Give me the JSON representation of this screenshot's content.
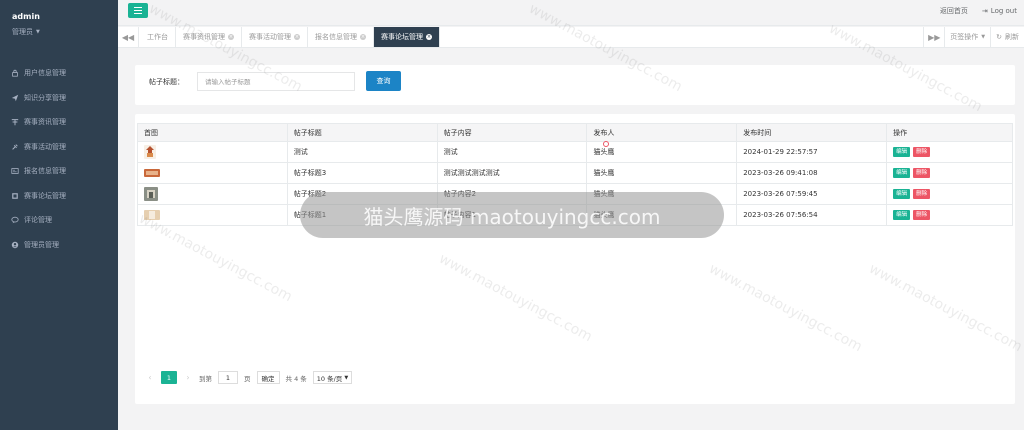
{
  "sidebar": {
    "user": "admin",
    "role": "管理员",
    "items": [
      {
        "label": "用户信息管理",
        "icon": "lock-icon"
      },
      {
        "label": "知识分享管理",
        "icon": "send-icon"
      },
      {
        "label": "赛事资讯管理",
        "icon": "news-icon"
      },
      {
        "label": "赛事活动管理",
        "icon": "plug-icon"
      },
      {
        "label": "报名信息管理",
        "icon": "id-card-icon"
      },
      {
        "label": "赛事论坛管理",
        "icon": "forum-icon"
      },
      {
        "label": "评论管理",
        "icon": "comment-icon"
      },
      {
        "label": "管理员管理",
        "icon": "user-icon"
      }
    ]
  },
  "header": {
    "home_link": "返回首页",
    "logout": "Log out"
  },
  "tabs": {
    "items": [
      {
        "label": "工作台",
        "closable": false,
        "active": false
      },
      {
        "label": "赛事资讯管理",
        "closable": true,
        "active": false
      },
      {
        "label": "赛事活动管理",
        "closable": true,
        "active": false
      },
      {
        "label": "报名信息管理",
        "closable": true,
        "active": false
      },
      {
        "label": "赛事论坛管理",
        "closable": true,
        "active": true
      }
    ],
    "page_ops": "页签操作",
    "refresh": "刷新"
  },
  "search": {
    "label": "帖子标题：",
    "placeholder": "请输入帖子标题",
    "button": "查询"
  },
  "table": {
    "headers": [
      "首图",
      "帖子标题",
      "帖子内容",
      "发布人",
      "发布时间",
      "操作"
    ],
    "rows": [
      {
        "title": "测试",
        "content": "测试",
        "author": "猫头鹰",
        "time": "2024-01-29 22:57:57"
      },
      {
        "title": "帖子标题3",
        "content": "测试测试测试测试",
        "author": "猫头鹰",
        "time": "2023-03-26 09:41:08"
      },
      {
        "title": "帖子标题2",
        "content": "帖子内容2",
        "author": "猫头鹰",
        "time": "2023-03-26 07:59:45"
      },
      {
        "title": "帖子标题1",
        "content": "帖子内容1",
        "author": "猫头鹰",
        "time": "2023-03-26 07:56:54"
      }
    ],
    "edit_label": "编辑",
    "delete_label": "删除"
  },
  "pagination": {
    "current": "1",
    "goto_prefix": "到第",
    "goto_value": "1",
    "goto_suffix": "页",
    "confirm": "确定",
    "total": "共 4 条",
    "page_size": "10 条/页"
  },
  "watermark": {
    "banner": "猫头鹰源码 maotouyingcc.com",
    "repeat": "www.maotouyingcc.com"
  },
  "colors": {
    "sidebar": "#2f4050",
    "primary": "#1ab394",
    "search_button": "#1c84c6",
    "danger": "#ed5565"
  }
}
